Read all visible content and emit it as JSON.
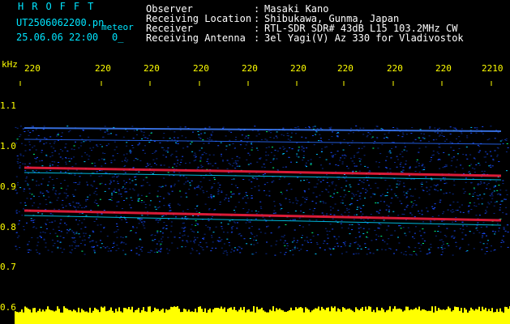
{
  "header": {
    "app_title": "HROFFT",
    "filename": "UT2506062200.pn",
    "mode": "meteor",
    "datetime": "25.06.06 22:00",
    "counter": "0_",
    "info": [
      {
        "label": "Observer",
        "value": "Masaki Kano"
      },
      {
        "label": "Receiving Location",
        "value": "Shibukawa, Gunma, Japan"
      },
      {
        "label": "Receiver",
        "value": "RTL-SDR SDR# 43dB L15 103.2MHz CW"
      },
      {
        "label": "Receiving Antenna",
        "value": "3el Yagi(V) Az 330 for Vladivostok"
      }
    ],
    "separator": ":"
  },
  "axis": {
    "unit": "kHz",
    "y_labels": [
      "1.1",
      "1.0",
      "0.9",
      "0.8",
      "0.7",
      "0.6"
    ],
    "time_ticks": [
      "220",
      "220",
      "220",
      "220",
      "220",
      "220",
      "220",
      "220",
      "220",
      "2210"
    ]
  },
  "colors": {
    "background": "#000000",
    "text_cyan": "#00e5ff",
    "text_white": "#ffffff",
    "axis_yellow": "#ffff00",
    "signal_red": "#ff2040",
    "noise_blue": "#1a3cff"
  }
}
